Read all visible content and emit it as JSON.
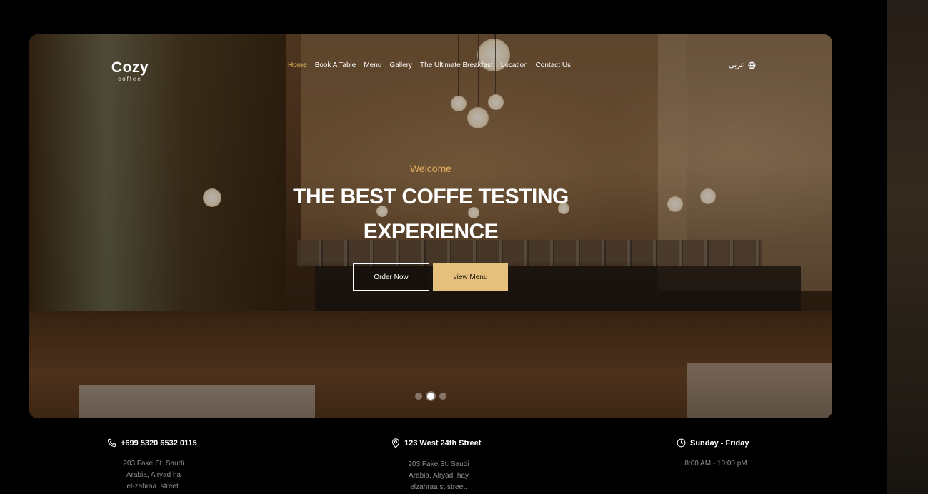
{
  "brand": {
    "name": "Cozy",
    "tagline": "coffee"
  },
  "nav": {
    "items": [
      {
        "label": "Home",
        "active": true
      },
      {
        "label": "Book A Table",
        "active": false
      },
      {
        "label": "Menu",
        "active": false
      },
      {
        "label": "Gallery",
        "active": false
      },
      {
        "label": "The Ultimate Breakfast",
        "active": false
      },
      {
        "label": "Location",
        "active": false
      },
      {
        "label": "Contact Us",
        "active": false
      }
    ],
    "language": {
      "label": "عربي",
      "icon": "globe-icon"
    }
  },
  "hero": {
    "welcome": "Welcome",
    "headline_line1": "THE BEST COFFE TESTING",
    "headline_line2": "EXPERIENCE",
    "primary_button": "Order Now",
    "secondary_button": "view Menu",
    "slider": {
      "count": 3,
      "active_index": 1
    }
  },
  "info": {
    "phone": {
      "icon": "phone-icon",
      "title": "+699  5320 6532 0115",
      "lines": [
        "203 Fake St. Saudi",
        "Arabia, Alryad ha",
        "el-zahraa .street."
      ]
    },
    "address": {
      "icon": "map-pin-icon",
      "title": "123 West 24th Street",
      "lines": [
        "203 Fake St. Saudi",
        "Arabia, Alryad, hay",
        "elzahraa  st.street."
      ]
    },
    "hours": {
      "icon": "clock-icon",
      "title": "Sunday - Friday",
      "lines": [
        "8:00 AM - 10:00 pM"
      ]
    }
  },
  "colors": {
    "accent": "#e8b85a",
    "button_fill": "#e4c07c",
    "background": "#000000",
    "muted_text": "#8f8f8f"
  }
}
